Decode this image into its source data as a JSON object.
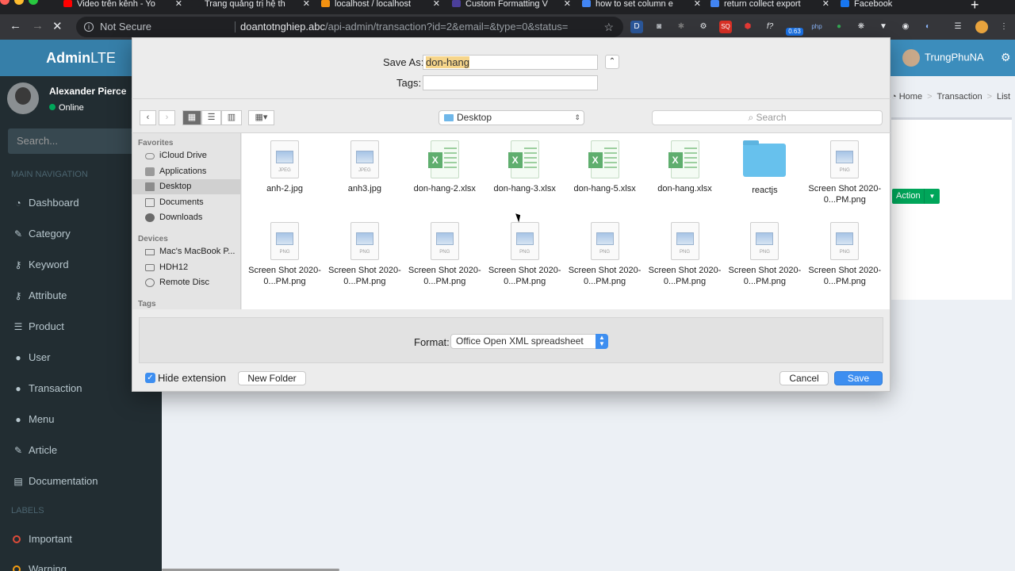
{
  "browser": {
    "tabs": [
      {
        "label": "Video trên kênh - Yo",
        "color": "#ff0000"
      },
      {
        "label": "Trang quảng trị hệ th",
        "color": "#202124"
      },
      {
        "label": "localhost / localhost",
        "color": "#f29111"
      },
      {
        "label": "Custom Formatting V",
        "color": "#4b3f9a"
      },
      {
        "label": "how to set column e",
        "color": "#4285f4"
      },
      {
        "label": "return collect export",
        "color": "#4285f4"
      },
      {
        "label": "Facebook",
        "color": "#1877f2"
      }
    ],
    "not_secure": "Not Secure",
    "url_host": "doantotnghiep.abc",
    "url_path": "/api-admin/transaction?id=2&email=&type=0&status=",
    "ext_badge": "0.63"
  },
  "app": {
    "logo_bold": "Admin",
    "logo_rest": "LTE",
    "header_user": "TrungPhuNA",
    "user_name": "Alexander Pierce",
    "user_status": "Online",
    "search_placeholder": "Search...",
    "main_nav_header": "MAIN NAVIGATION",
    "labels_header": "LABELS",
    "menu": [
      {
        "label": "Dashboard",
        "icon": "dashboard-icon",
        "glyph": "◔"
      },
      {
        "label": "Category",
        "icon": "edit-icon",
        "glyph": "✎"
      },
      {
        "label": "Keyword",
        "icon": "key-icon",
        "glyph": "⚷"
      },
      {
        "label": "Attribute",
        "icon": "key-icon",
        "glyph": "⚷"
      },
      {
        "label": "Product",
        "icon": "database-icon",
        "glyph": "☰"
      },
      {
        "label": "User",
        "icon": "user-icon",
        "glyph": "●"
      },
      {
        "label": "Transaction",
        "icon": "user-icon",
        "glyph": "●"
      },
      {
        "label": "Menu",
        "icon": "user-icon",
        "glyph": "●"
      },
      {
        "label": "Article",
        "icon": "edit-icon",
        "glyph": "✎"
      },
      {
        "label": "Documentation",
        "icon": "book-icon",
        "glyph": "▤"
      }
    ],
    "labels": [
      "Important",
      "Warning"
    ],
    "breadcrumb": [
      "Home",
      "Transaction",
      "List"
    ],
    "action_label": "Action"
  },
  "dialog": {
    "save_as_label": "Save As:",
    "save_as_value": "don-hang",
    "tags_label": "Tags:",
    "location": "Desktop",
    "search_placeholder": "Search",
    "favorites_header": "Favorites",
    "favorites": [
      "iCloud Drive",
      "Applications",
      "Desktop",
      "Documents",
      "Downloads"
    ],
    "devices_header": "Devices",
    "devices": [
      "Mac's MacBook P...",
      "HDH12",
      "Remote Disc"
    ],
    "tags_header": "Tags",
    "files": [
      {
        "name": "anh-2.jpg",
        "kind": "JPEG"
      },
      {
        "name": "anh3.jpg",
        "kind": "JPEG"
      },
      {
        "name": "don-hang-2.xlsx",
        "kind": "xlsx"
      },
      {
        "name": "don-hang-3.xlsx",
        "kind": "xlsx"
      },
      {
        "name": "don-hang-5.xlsx",
        "kind": "xlsx"
      },
      {
        "name": "don-hang.xlsx",
        "kind": "xlsx"
      },
      {
        "name": "reactjs",
        "kind": "folder"
      },
      {
        "name": "Screen Shot 2020-0...PM.png",
        "kind": "PNG"
      },
      {
        "name": "Screen Shot 2020-0...PM.png",
        "kind": "PNG"
      },
      {
        "name": "Screen Shot 2020-0...PM.png",
        "kind": "PNG"
      },
      {
        "name": "Screen Shot 2020-0...PM.png",
        "kind": "PNG"
      },
      {
        "name": "Screen Shot 2020-0...PM.png",
        "kind": "PNG"
      },
      {
        "name": "Screen Shot 2020-0...PM.png",
        "kind": "PNG"
      },
      {
        "name": "Screen Shot 2020-0...PM.png",
        "kind": "PNG"
      },
      {
        "name": "Screen Shot 2020-0...PM.png",
        "kind": "PNG"
      },
      {
        "name": "Screen Shot 2020-0...PM.png",
        "kind": "PNG"
      }
    ],
    "format_label": "Format:",
    "format_value": "Office Open XML spreadsheet",
    "hide_extension_label": "Hide extension",
    "hide_extension_checked": true,
    "new_folder_label": "New Folder",
    "cancel_label": "Cancel",
    "save_label": "Save"
  },
  "colors": {
    "header": "#3c8dbc",
    "sidebar": "#222d32",
    "primary_button": "#3d8ef0",
    "action_button": "#00a65a"
  }
}
